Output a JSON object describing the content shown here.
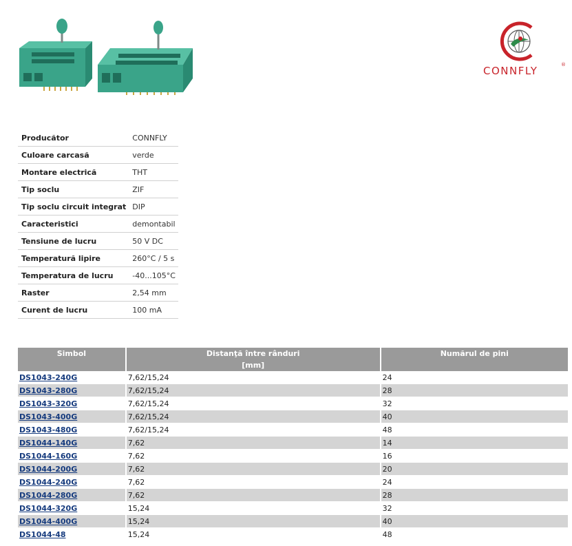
{
  "brand": {
    "name": "CONNFLY",
    "registered_mark": "®",
    "colors": {
      "red": "#c8232a",
      "green": "#2e8b4a"
    }
  },
  "images": {
    "description_icons": [
      "zif-socket-small-icon",
      "zif-socket-large-icon"
    ]
  },
  "specs": [
    {
      "label": "Producător",
      "value": "CONNFLY"
    },
    {
      "label": "Culoare carcasă",
      "value": "verde"
    },
    {
      "label": "Montare electrică",
      "value": "THT"
    },
    {
      "label": "Tip soclu",
      "value": "ZIF"
    },
    {
      "label": "Tip soclu circuit integrat",
      "value": "DIP"
    },
    {
      "label": "Caracteristici",
      "value": "demontabil"
    },
    {
      "label": "Tensiune de lucru",
      "value": "50 V DC"
    },
    {
      "label": "Temperatură lipire",
      "value": "260°C / 5 s"
    },
    {
      "label": "Temperatura de lucru",
      "value": "-40...105°C"
    },
    {
      "label": "Raster",
      "value": "2,54 mm"
    },
    {
      "label": "Curent de lucru",
      "value": "100 mA"
    }
  ],
  "models": {
    "headers": {
      "symbol": "Simbol",
      "spacing": "Distanţă între rânduri",
      "spacing_unit": "[mm]",
      "pins": "Numărul de pini"
    },
    "rows": [
      {
        "symbol": "DS1043-240G",
        "spacing": "7,62/15,24",
        "pins": "24"
      },
      {
        "symbol": "DS1043-280G",
        "spacing": "7,62/15,24",
        "pins": "28"
      },
      {
        "symbol": "DS1043-320G",
        "spacing": "7,62/15,24",
        "pins": "32"
      },
      {
        "symbol": "DS1043-400G",
        "spacing": "7,62/15,24",
        "pins": "40"
      },
      {
        "symbol": "DS1043-480G",
        "spacing": "7,62/15,24",
        "pins": "48"
      },
      {
        "symbol": "DS1044-140G",
        "spacing": "7,62",
        "pins": "14"
      },
      {
        "symbol": "DS1044-160G",
        "spacing": "7,62",
        "pins": "16"
      },
      {
        "symbol": "DS1044-200G",
        "spacing": "7,62",
        "pins": "20"
      },
      {
        "symbol": "DS1044-240G",
        "spacing": "7,62",
        "pins": "24"
      },
      {
        "symbol": "DS1044-280G",
        "spacing": "7,62",
        "pins": "28"
      },
      {
        "symbol": "DS1044-320G",
        "spacing": "15,24",
        "pins": "32"
      },
      {
        "symbol": "DS1044-400G",
        "spacing": "15,24",
        "pins": "40"
      },
      {
        "symbol": "DS1044-48",
        "spacing": "15,24",
        "pins": "48"
      }
    ]
  }
}
